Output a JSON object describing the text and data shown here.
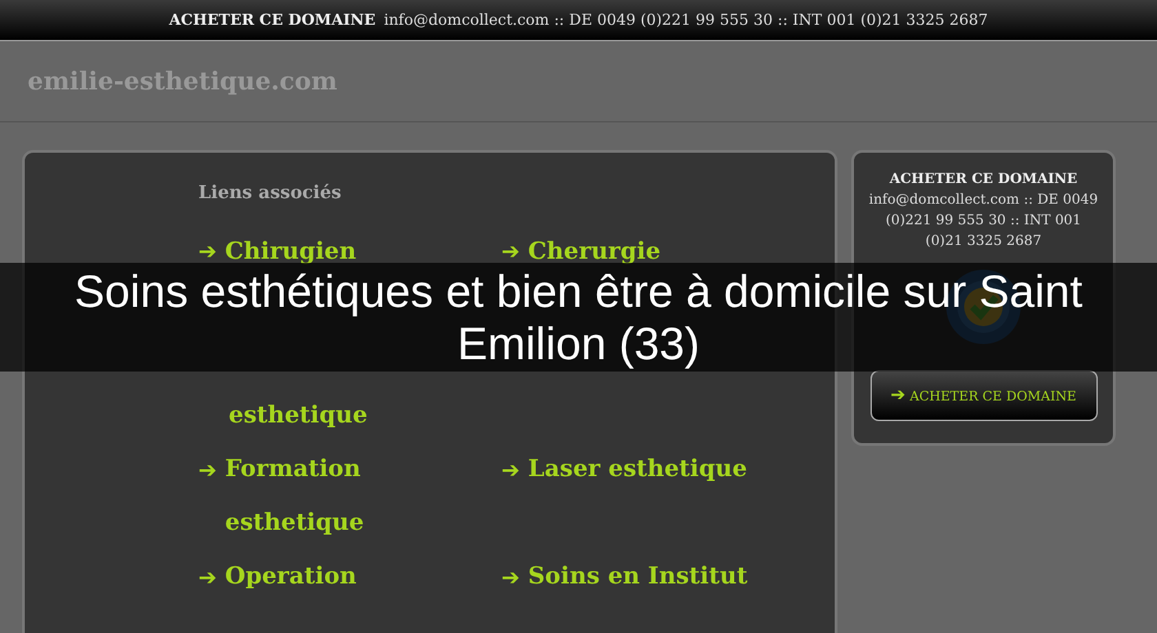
{
  "top_bar": {
    "title": "ACHETER CE DOMAINE",
    "contact": "info@domcollect.com :: DE 0049 (0)221 99 555 30 :: INT 001 (0)21 3325 2687"
  },
  "site": {
    "domain": "emilie-esthetique.com"
  },
  "links_panel": {
    "heading": "Liens associés",
    "arrow": "➔",
    "left_links": [
      {
        "kind": "link",
        "label": "Chirugien"
      },
      {
        "kind": "continuation",
        "label": "esthetique"
      },
      {
        "kind": "link",
        "label": "Formation esthetique"
      },
      {
        "kind": "link",
        "label": "Operation"
      }
    ],
    "right_links": [
      {
        "kind": "link",
        "label": "Cherurgie"
      },
      {
        "kind": "link",
        "label": "Laser esthetique"
      },
      {
        "kind": "link",
        "label": "Soins en Institut"
      }
    ]
  },
  "sale_panel": {
    "title": "ACHETER CE DOMAINE",
    "contact": "info@domcollect.com :: DE 0049 (0)221 99 555 30 :: INT 001 (0)21 3325 2687",
    "button": {
      "arrow": "➔",
      "label": "ACHETER CE DOMAINE"
    }
  },
  "caption": {
    "text": "Soins esthétiques et bien être à domicile sur Saint Emilion (33)"
  }
}
